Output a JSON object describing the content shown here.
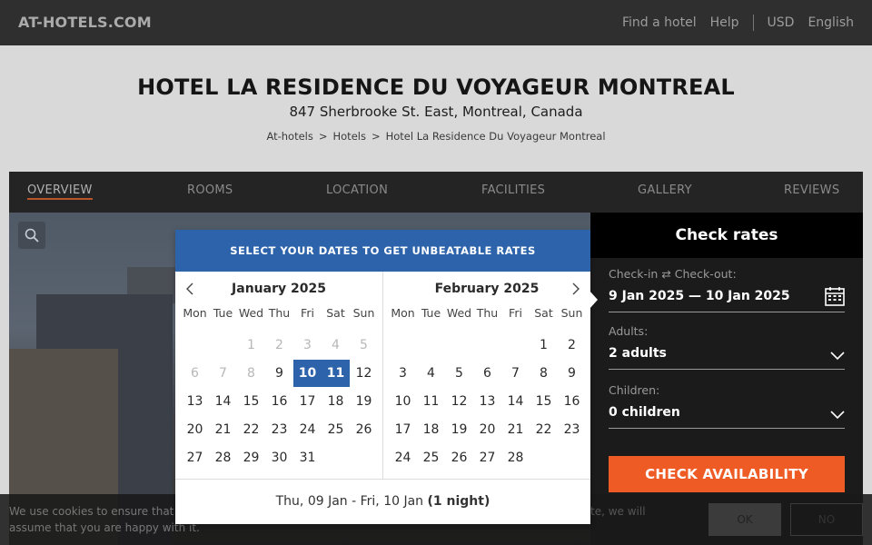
{
  "topbar": {
    "logo": "AT-HOTELS.COM",
    "nav": [
      "Find a hotel",
      "Help"
    ],
    "currency": "USD",
    "language": "English"
  },
  "hero": {
    "title": "HOTEL LA RESIDENCE DU VOYAGEUR MONTREAL",
    "address": "847 Sherbrooke St. East, Montreal, Canada",
    "breadcrumb": [
      "At-hotels",
      "Hotels",
      "Hotel La Residence Du Voyageur Montreal"
    ],
    "breadcrumb_sep": ">"
  },
  "tabs": [
    "OVERVIEW",
    "ROOMS",
    "LOCATION",
    "FACILITIES",
    "GALLERY",
    "REVIEWS"
  ],
  "rates": {
    "title": "Check rates",
    "checkin_label": "Check-in ⇄ Check-out:",
    "checkin_value": "9 Jan 2025 — 10 Jan 2025",
    "adults_label": "Adults:",
    "adults_value": "2 adults",
    "children_label": "Children:",
    "children_value": "0 children",
    "button": "CHECK AVAILABILITY"
  },
  "cookie": {
    "text": "We use cookies to ensure that assume that you are happy with it.",
    "text_right": "te, we will",
    "ok": "OK",
    "no": "NO"
  },
  "picker": {
    "header": "SELECT YOUR DATES TO GET UNBEATABLE RATES",
    "weekdays": [
      "Mon",
      "Tue",
      "Wed",
      "Thu",
      "Fri",
      "Sat",
      "Sun"
    ],
    "months": [
      {
        "name": "January 2025",
        "weeks": [
          [
            "",
            "",
            "1",
            "2",
            "3",
            "4",
            "5"
          ],
          [
            "6",
            "7",
            "8",
            "9",
            "10",
            "11",
            "12"
          ],
          [
            "13",
            "14",
            "15",
            "16",
            "17",
            "18",
            "19"
          ],
          [
            "20",
            "21",
            "22",
            "23",
            "24",
            "25",
            "26"
          ],
          [
            "27",
            "28",
            "29",
            "30",
            "31",
            "",
            ""
          ]
        ],
        "muted": [
          "1",
          "2",
          "3",
          "4",
          "5",
          "6",
          "7",
          "8"
        ],
        "selected": [
          "10",
          "11"
        ]
      },
      {
        "name": "February 2025",
        "weeks": [
          [
            "",
            "",
            "",
            "",
            "",
            "1",
            "2"
          ],
          [
            "3",
            "4",
            "5",
            "6",
            "7",
            "8",
            "9"
          ],
          [
            "10",
            "11",
            "12",
            "13",
            "14",
            "15",
            "16"
          ],
          [
            "17",
            "18",
            "19",
            "20",
            "21",
            "22",
            "23"
          ],
          [
            "24",
            "25",
            "26",
            "27",
            "28",
            "",
            ""
          ]
        ],
        "muted": [],
        "selected": []
      }
    ],
    "summary": "Thu, 09 Jan - Fri, 10 Jan",
    "nights": "(1 night)"
  }
}
